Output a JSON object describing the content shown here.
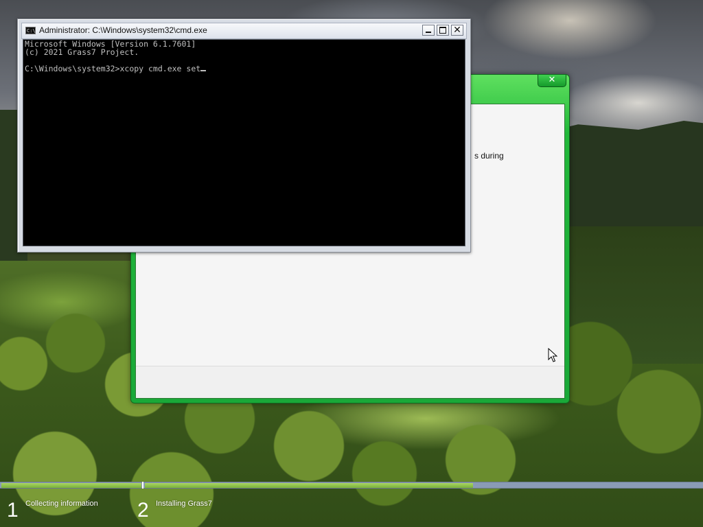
{
  "setup_window": {
    "close_glyph": "✕",
    "partial_text": "s during"
  },
  "cmd_window": {
    "title": "Administrator: C:\\Windows\\system32\\cmd.exe",
    "icon_text": "C:\\",
    "buttons": {
      "minimize": "",
      "maximize": "",
      "close": "✕"
    },
    "console_lines": [
      "Microsoft Windows [Version 6.1.7601]",
      "(c) 2021 Grass7 Project.",
      "",
      "C:\\Windows\\system32>xcopy cmd.exe set"
    ]
  },
  "progress": {
    "steps": [
      {
        "number": "1",
        "label": "Collecting information"
      },
      {
        "number": "2",
        "label": "Installing Grass7"
      }
    ],
    "installing_progress": 0.59
  },
  "colors": {
    "setup_frame": "#22b83a",
    "progress_fill": "#78b238",
    "progress_track": "#8a9bb5",
    "console_bg": "#000000",
    "console_text": "#c0c0c0"
  },
  "icons": {
    "pointer": "mouse-pointer-icon",
    "cmd": "cmd-icon"
  }
}
